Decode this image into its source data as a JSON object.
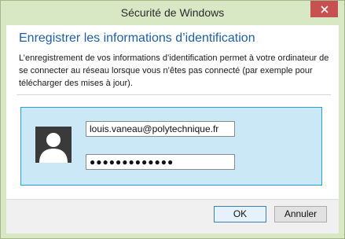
{
  "window": {
    "title": "Sécurité de Windows",
    "close_icon": "close-icon"
  },
  "content": {
    "heading": "Enregistrer les informations d’identification",
    "description": "L’enregistrement de vos informations d’identification permet à votre ordinateur de se connecter au réseau lorsque vous n’êtes pas connecté (par exemple pour télécharger des mises à jour)."
  },
  "credentials": {
    "avatar_icon": "user-avatar-icon",
    "username": "louis.vaneau@polytechnique.fr",
    "password_mask": "●●●●●●●●●●●●●"
  },
  "buttons": {
    "ok_label": "OK",
    "cancel_label": "Annuler"
  },
  "colors": {
    "window_frame": "#d9e8c4",
    "close_button": "#c75050",
    "heading": "#1f5fa8",
    "panel_fill": "#cbe8f6",
    "panel_border": "#26a0da"
  }
}
